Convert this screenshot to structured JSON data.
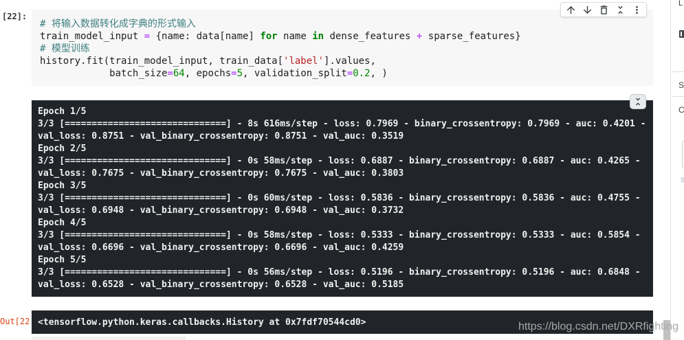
{
  "cell": {
    "prompt": "[22]:",
    "toolbar": {
      "buttons": [
        {
          "icon": "arrow-up-icon"
        },
        {
          "icon": "arrow-down-icon"
        },
        {
          "icon": "trash-icon"
        },
        {
          "icon": "unfold-less-icon"
        },
        {
          "icon": "more-vertical-icon"
        }
      ]
    },
    "code_lines": [
      [
        {
          "comment": "# 将输入数据转化成字典的形式输入"
        }
      ],
      [
        {
          "plain": "train_model_input "
        },
        {
          "operator": "="
        },
        {
          "plain": " {name: data[name] "
        },
        {
          "keyword": "for"
        },
        {
          "plain": " name "
        },
        {
          "keyword": "in"
        },
        {
          "plain": " dense_features "
        },
        {
          "operator": "+"
        },
        {
          "plain": " sparse_features}"
        }
      ],
      [
        {
          "comment": "# 模型训练"
        }
      ],
      [
        {
          "plain": "history.fit(train_model_input, train_data["
        },
        {
          "string": "'label'"
        },
        {
          "plain": "].values,"
        }
      ],
      [
        {
          "plain": "            batch_size"
        },
        {
          "operator": "="
        },
        {
          "number": "64"
        },
        {
          "plain": ", epochs"
        },
        {
          "operator": "="
        },
        {
          "number": "5"
        },
        {
          "plain": ", validation_split"
        },
        {
          "operator": "="
        },
        {
          "number": "0.2"
        },
        {
          "plain": ", )"
        }
      ]
    ]
  },
  "output": {
    "collapse_icon": "unfold-less-icon",
    "stream_lines": [
      "Epoch 1/5",
      "3/3 [==============================] - 8s 616ms/step - loss: 0.7969 - binary_crossentropy: 0.7969 - auc: 0.4201 -",
      "val_loss: 0.8751 - val_binary_crossentropy: 0.8751 - val_auc: 0.3519",
      "Epoch 2/5",
      "3/3 [==============================] - 0s 58ms/step - loss: 0.6887 - binary_crossentropy: 0.6887 - auc: 0.4265 -",
      "val_loss: 0.7675 - val_binary_crossentropy: 0.7675 - val_auc: 0.3803",
      "Epoch 3/5",
      "3/3 [==============================] - 0s 60ms/step - loss: 0.5836 - binary_crossentropy: 0.5836 - auc: 0.4755 -",
      "val_loss: 0.6948 - val_binary_crossentropy: 0.6948 - val_auc: 0.3732",
      "Epoch 4/5",
      "3/3 [==============================] - 0s 58ms/step - loss: 0.5333 - binary_crossentropy: 0.5333 - auc: 0.5854 -",
      "val_loss: 0.6696 - val_binary_crossentropy: 0.6696 - val_auc: 0.4259",
      "Epoch 5/5",
      "3/3 [==============================] - 0s 56ms/step - loss: 0.5196 - binary_crossentropy: 0.5196 - auc: 0.6848 -",
      "val_loss: 0.6528 - val_binary_crossentropy: 0.6528 - val_auc: 0.5185"
    ],
    "result_prompt": "Out[22",
    "result_text": "<tensorflow.python.keras.callbacks.History at 0x7fdf70544cd0>"
  },
  "right_panel": {
    "top_glyph": "L",
    "icon": "panel-icon",
    "section_1_glyph": "S",
    "section_2_glyph": "C",
    "caption_glyph": "S"
  },
  "watermark": "https://blog.csdn.net/DXRfighting",
  "colors": {
    "comment": "#408080",
    "operator": "#aa22ff",
    "keyword": "#008000",
    "string": "#ba2121",
    "number": "#008800",
    "plain": "#202124",
    "code_bg": "#f7f7f7",
    "output_bg": "#212529",
    "output_text": "#f1f1f1",
    "out_prompt": "#d84315",
    "watermark": "#a8a8a8"
  }
}
